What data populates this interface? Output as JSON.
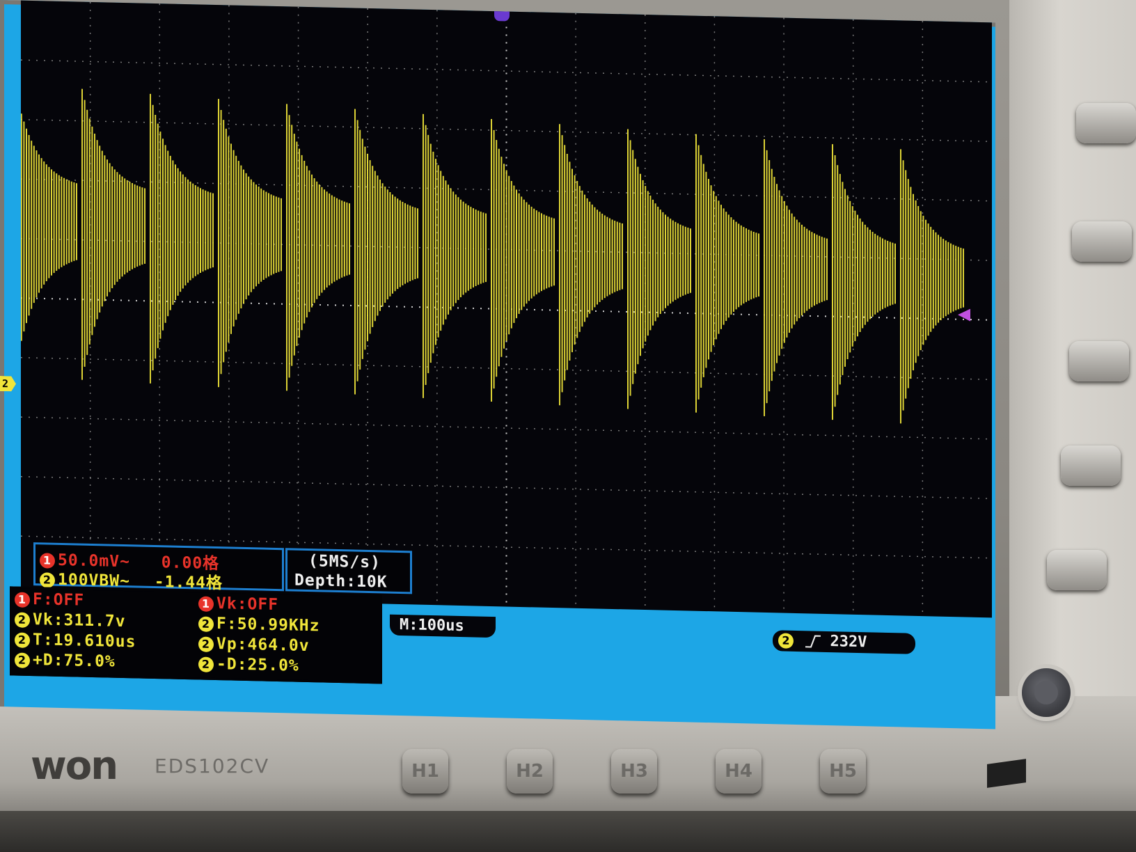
{
  "device": {
    "brand": "won",
    "model": "EDS102CV",
    "colors": {
      "screen_frame": "#1da6e6",
      "trace": "#f0e53a",
      "ch1": "#e8332a",
      "grid": "#ffffff"
    }
  },
  "channels": {
    "ch1": {
      "badge": "1",
      "scale": "50.0mV~",
      "offset": "0.00格"
    },
    "ch2": {
      "badge": "2",
      "scale": "100VBW~",
      "offset": "-1.44格"
    }
  },
  "acquisition": {
    "rate": "(5MS/s)",
    "depth": "Depth:10K"
  },
  "measurements": {
    "left": [
      {
        "badge": "1",
        "text": "F:OFF",
        "color": "red"
      },
      {
        "badge": "2",
        "text": "Vk:311.7v",
        "color": "yellow"
      },
      {
        "badge": "2",
        "text": "T:19.610us",
        "color": "yellow"
      },
      {
        "badge": "2",
        "text": "+D:75.0%",
        "color": "yellow"
      }
    ],
    "right": [
      {
        "badge": "1",
        "text": "Vk:OFF",
        "color": "red"
      },
      {
        "badge": "2",
        "text": "F:50.99KHz",
        "color": "yellow"
      },
      {
        "badge": "2",
        "text": "Vp:464.0v",
        "color": "yellow"
      },
      {
        "badge": "2",
        "text": "-D:25.0%",
        "color": "yellow"
      }
    ]
  },
  "timebase": "M:100us",
  "trigger": {
    "badge": "2",
    "level": "232V"
  },
  "markers": {
    "ch2_ground": "2"
  },
  "hkeys": [
    "H1",
    "H2",
    "H3",
    "H4",
    "H5"
  ],
  "icons": {
    "trigger_edge": "rising-edge-icon",
    "knob": "rotary-knob-icon"
  }
}
